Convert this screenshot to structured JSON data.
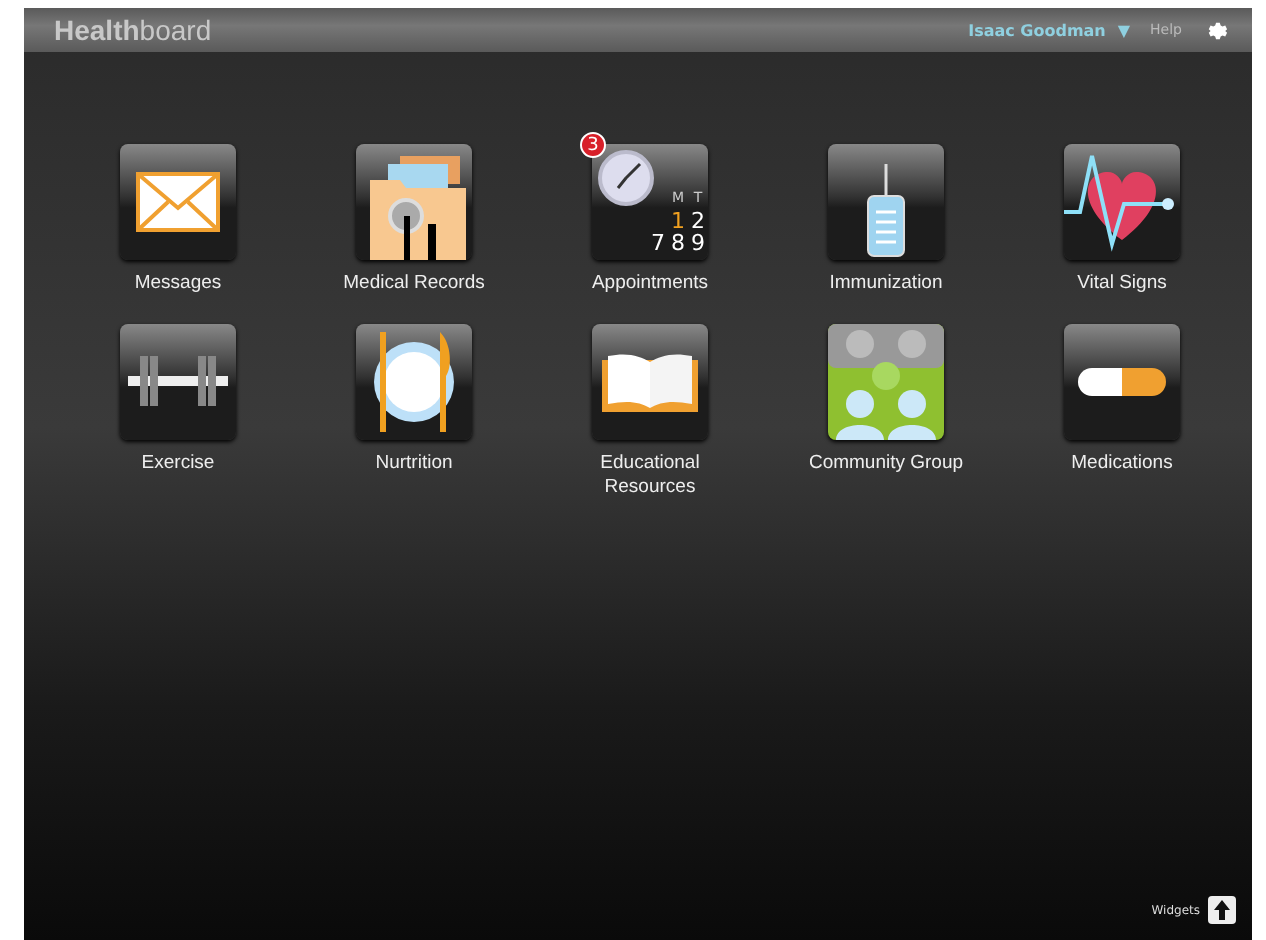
{
  "header": {
    "logo": "**Health**board",
    "user": "Isaac Goodman",
    "user_menu_caret": "▼",
    "help": "Help"
  },
  "apps": [
    {
      "kind": "messages",
      "label": "Messages"
    },
    {
      "kind": "records",
      "label": "Medical Records"
    },
    {
      "kind": "appointments",
      "label": "Appointments",
      "badge": "3",
      "calendar": [
        "M",
        "T",
        "1",
        "2",
        "7",
        "8",
        "9"
      ]
    },
    {
      "kind": "immunization",
      "label": "Immunization"
    },
    {
      "kind": "vitals",
      "label": "Vital Signs"
    },
    {
      "kind": "exercise",
      "label": "Exercise"
    },
    {
      "kind": "nutrition",
      "label": "Nurtrition"
    },
    {
      "kind": "education",
      "label": "Educational Resources"
    },
    {
      "kind": "community",
      "label": "Community Group"
    },
    {
      "kind": "medications",
      "label": "Medications"
    }
  ],
  "footer": {
    "widgets": "Widgets"
  }
}
